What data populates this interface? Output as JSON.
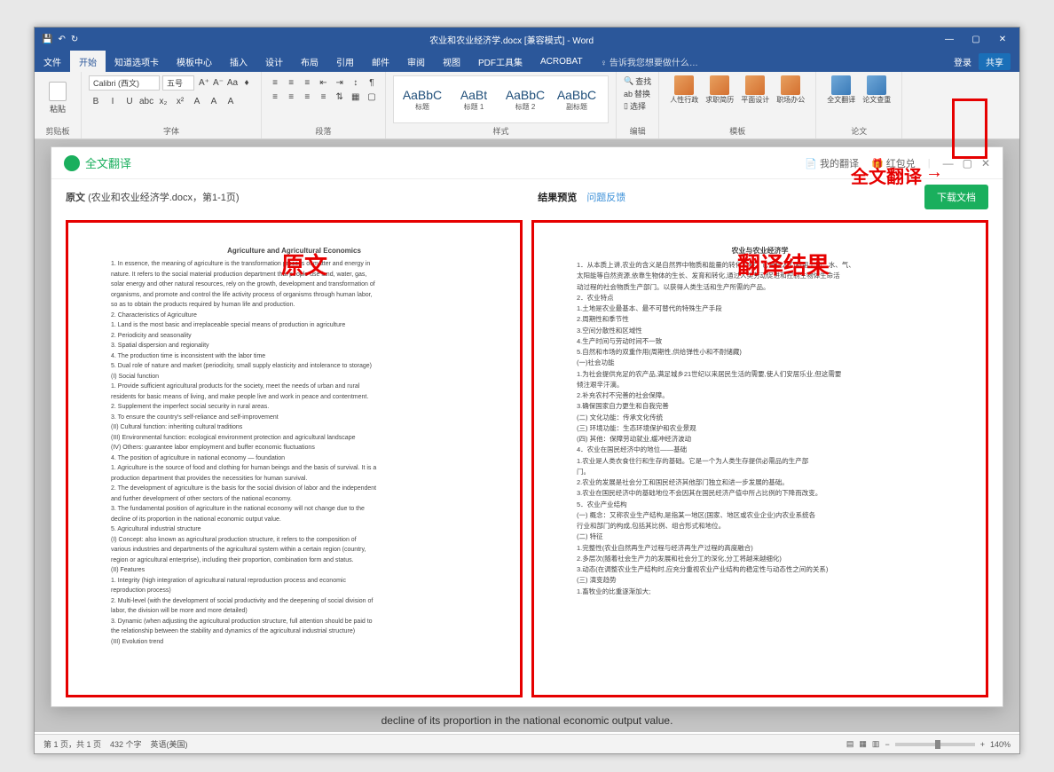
{
  "titlebar": {
    "filename": "农业和农业经济学.docx [兼容模式] - Word",
    "qat": {
      "save": "💾",
      "undo": "↶",
      "redo": "↻"
    },
    "win": {
      "min": "—",
      "max": "▢",
      "close": "✕"
    }
  },
  "ribbon_tabs": [
    "文件",
    "开始",
    "知道选项卡",
    "模板中心",
    "插入",
    "设计",
    "布局",
    "引用",
    "邮件",
    "审阅",
    "视图",
    "PDF工具集",
    "ACROBAT"
  ],
  "active_tab_index": 1,
  "tell_me": "♀ 告诉我您想要做什么…",
  "ribbon_right": {
    "login": "登录",
    "share": "共享"
  },
  "ribbon": {
    "clipboard": {
      "paste": "粘贴",
      "group": "剪贴板"
    },
    "font": {
      "name": "Calibri (西文)",
      "size": "五号",
      "group": "字体",
      "btns_row1": [
        "A⁺",
        "A⁻",
        "Aa",
        "♦"
      ],
      "btns_row2": [
        "B",
        "I",
        "U",
        "abc",
        "x₂",
        "x²",
        "A",
        "A",
        "A"
      ]
    },
    "paragraph": {
      "group": "段落"
    },
    "styles": {
      "group": "样式",
      "items": [
        {
          "sample": "AaBbC",
          "label": "标题"
        },
        {
          "sample": "AaBt",
          "label": "标题 1"
        },
        {
          "sample": "AaBbC",
          "label": "标题 2"
        },
        {
          "sample": "AaBbC",
          "label": "副标题"
        }
      ]
    },
    "editing": {
      "find": "查找",
      "replace": "替换",
      "select": "选择",
      "group": "编辑"
    },
    "addins": [
      {
        "label": "人性行政"
      },
      {
        "label": "求职简历"
      },
      {
        "label": "平面设计"
      },
      {
        "label": "职场办公"
      },
      {
        "label": "全文翻译"
      },
      {
        "label": "论文查重"
      }
    ],
    "addin_group1": "模板",
    "addin_group2": "论文"
  },
  "annotations": {
    "translate_label": "全文翻译",
    "arrow": "→",
    "original": "原文",
    "result": "翻译结果"
  },
  "dialog": {
    "title": "全文翻译",
    "my_translations": "我的翻译",
    "bonus": "红包兑",
    "file_label": "原文",
    "file_info": "(农业和农业经济学.docx，第1-1页)",
    "center_label": "结果预览",
    "center_link": "问题反馈",
    "download": "下载文档",
    "win": {
      "min": "—",
      "max": "▢",
      "close": "✕"
    }
  },
  "original": {
    "title": "Agriculture and Agricultural Economics",
    "lines": [
      "1. In essence, the meaning of agriculture is the transformation process of matter and energy in",
      "nature. It refers to the social material production department that people use land, water, gas,",
      "solar energy and other natural resources, rely on the growth, development and transformation of",
      "organisms, and promote and control the life activity process of organisms through human labor,",
      "so as to obtain the products required by human life and production.",
      "2. Characteristics of Agriculture",
      "1. Land is the most basic and irreplaceable special means of production in agriculture",
      "2. Periodicity and seasonality",
      "3. Spatial dispersion and regionality",
      "4. The production time is inconsistent with the labor time",
      "5. Dual role of nature and market (periodicity, small supply elasticity and intolerance to storage)",
      "(I) Social function",
      "1. Provide sufficient agricultural products for the society, meet the needs of urban and rural",
      "residents for basic means of living, and make people live and work in peace and contentment.",
      "2. Supplement the imperfect social security in rural areas.",
      "3. To ensure the country's self-reliance and self-improvement",
      "(II) Cultural function: inheriting cultural traditions",
      "(III) Environmental function: ecological environment protection and agricultural landscape",
      "(IV) Others: guarantee labor employment and buffer economic fluctuations",
      "4. The position of agriculture in national economy — foundation",
      "1. Agriculture is the source of food and clothing for human beings and the basis of survival. It is a",
      "production department that provides the necessities for human survival.",
      "2. The development of agriculture is the basis for the social division of labor and the independent",
      "and further development of other sectors of the national economy.",
      "3. The fundamental position of agriculture in the national economy will not change due to the",
      "decline of its proportion in the national economic output value.",
      "5. Agricultural industrial structure",
      "(I) Concept: also known as agricultural production structure, it refers to the composition of",
      "various industries and departments of the agricultural system within a certain region (country,",
      "region or agricultural enterprise), including their proportion, combination form and status.",
      "(II) Features",
      "1. Integrity (high integration of agricultural natural reproduction process and economic",
      "reproduction process)",
      "2. Multi-level (with the development of social productivity and the deepening of social division of",
      "labor, the division will be more and more detailed)",
      "3. Dynamic (when adjusting the agricultural production structure, full attention should be paid to",
      "the relationship between the stability and dynamics of the agricultural industrial structure)",
      "(III) Evolution trend"
    ]
  },
  "translation": {
    "title": "农业与农业经济学",
    "lines": [
      "1．从本质上讲,农业的含义是自然界中物质和能量的转化过程。它是指人们利用土地、水、气、",
      "太阳能等自然资源,依靠生物体的生长、发育和转化,通过人类劳动促进和控制生物体生命活",
      "动过程的社会物质生产部门。以获得人类生活和生产所需的产品。",
      "2．农业特点",
      "1.土地是农业最基本、最不可替代的特殊生产手段",
      "2.周期性和季节性",
      "3.空间分散性和区域性",
      "4.生产时间与劳动时间不一致",
      "5.自然和市场的双重作用(周期性,供给弹性小和不耐储藏)",
      "(一)社会功能",
      "1.为社会提供充足的农产品,满足城乡21世纪以来居民生活的需要,使人们安居乐业,但这需要",
      "倾注艰辛汗滴。",
      "2.补充农村不完善的社会保障。",
      "3.确保国家自力更生和自我完善",
      "(二) 文化功能：传承文化传统",
      "(三) 环境功能：生态环境保护和农业景观",
      "(四) 其他：保障劳动就业,缓冲经济波动",
      "4．农业在国民经济中的地位——基础",
      "1.农业是人类衣食住行和生存的基础。它是一个为人类生存提供必需品的生产部",
      "门。",
      "2.农业的发展是社会分工和国民经济其他部门独立和进一步发展的基础。",
      "3.农业在国民经济中的基础地位不会因其在国民经济产值中所占比例的下降而改变。",
      "5．农业产业结构",
      "(一) 概念：又称农业生产结构,是指某一地区(国家、地区或农业企业)内农业系统各",
      "行业和部门的构成,包括其比例、组合形式和地位。",
      "(二) 特征",
      "1.完整性(农业自然再生产过程与经济再生产过程的高度融合)",
      "2.多层次(随着社会生产力的发展和社会分工的深化,分工将越来越细化)",
      "3.动态(在调整农业生产结构时,应充分重视农业产业结构的稳定性与动态性之间的关系)",
      "(三) 演变趋势",
      "1.畜牧业的比重逐渐加大;"
    ]
  },
  "bg_doc_line": "decline of its proportion in the national economic output value.",
  "statusbar": {
    "page": "第 1 页，共 1 页",
    "words": "432 个字",
    "lang": "英语(美国)",
    "zoom": "140%"
  }
}
